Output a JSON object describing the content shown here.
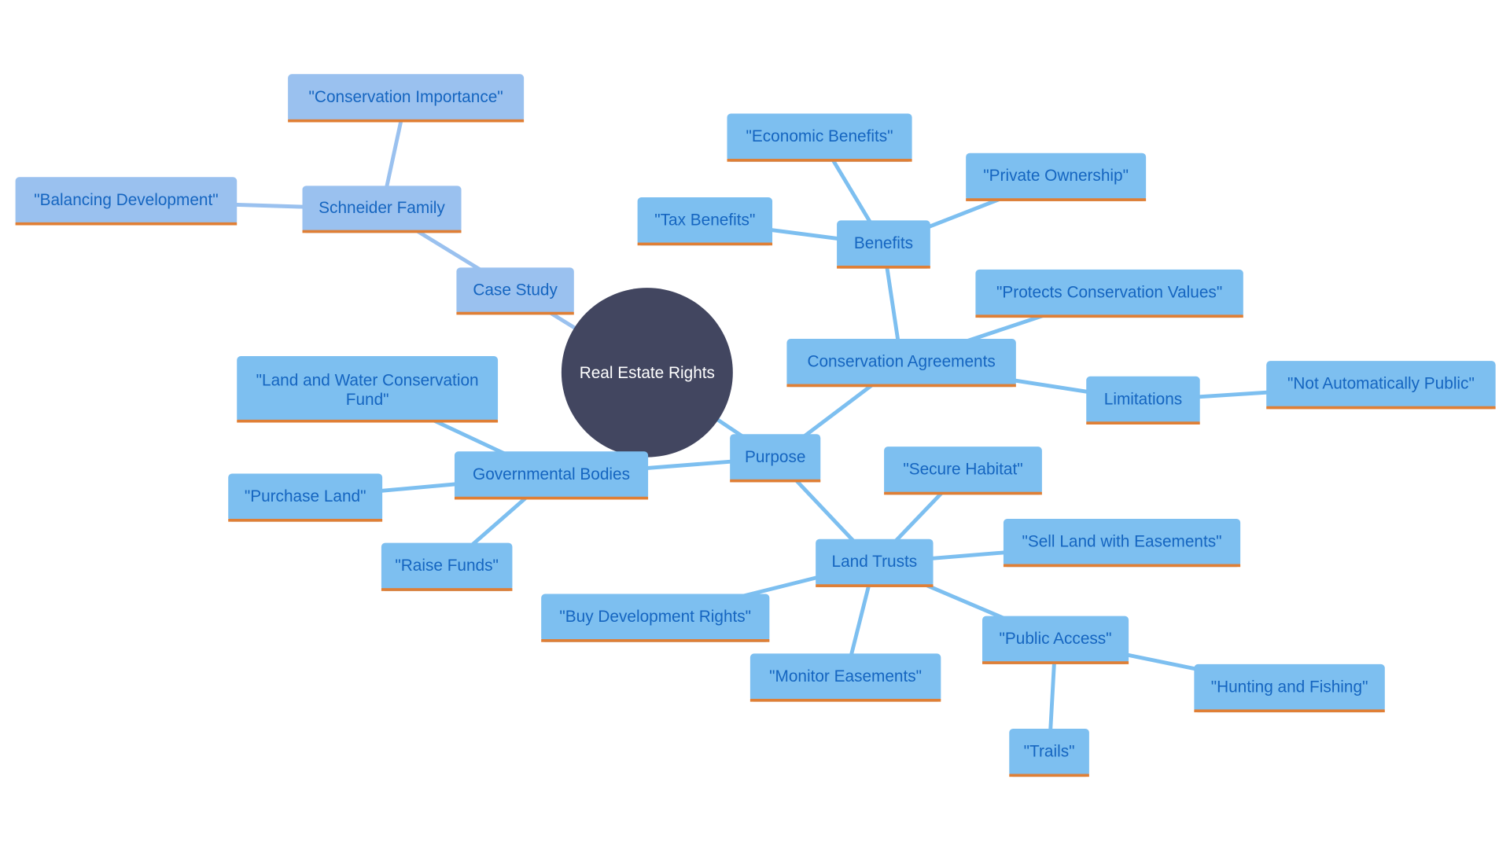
{
  "colors": {
    "background": "#ffffff",
    "root_fill": "#424660",
    "root_text": "#ffffff",
    "node_fill_primary": "#7dbff0",
    "node_fill_case": "#9ac1ef",
    "node_text": "#1565c0",
    "node_underline": "#e07f35",
    "edge_primary": "#7dbff0",
    "edge_case": "#9ac1ef"
  },
  "diagram": {
    "type": "mindmap",
    "root": {
      "id": "root",
      "label": "Real Estate Rights"
    },
    "nodes": [
      {
        "id": "case-study",
        "label": "Case Study",
        "parent": "root",
        "group": "case"
      },
      {
        "id": "schneider-family",
        "label": "Schneider Family",
        "parent": "case-study",
        "group": "case"
      },
      {
        "id": "conservation-importance",
        "label": "\"Conservation Importance\"",
        "parent": "schneider-family",
        "group": "case"
      },
      {
        "id": "balancing-development",
        "label": "\"Balancing Development\"",
        "parent": "schneider-family",
        "group": "case"
      },
      {
        "id": "purpose",
        "label": "Purpose",
        "parent": "root",
        "group": "primary"
      },
      {
        "id": "conservation-agreements",
        "label": "Conservation Agreements",
        "parent": "purpose",
        "group": "primary"
      },
      {
        "id": "benefits",
        "label": "Benefits",
        "parent": "conservation-agreements",
        "group": "primary"
      },
      {
        "id": "economic-benefits",
        "label": "\"Economic Benefits\"",
        "parent": "benefits",
        "group": "primary"
      },
      {
        "id": "private-ownership",
        "label": "\"Private Ownership\"",
        "parent": "benefits",
        "group": "primary"
      },
      {
        "id": "tax-benefits",
        "label": "\"Tax Benefits\"",
        "parent": "benefits",
        "group": "primary"
      },
      {
        "id": "protects-conservation-values",
        "label": "\"Protects Conservation Values\"",
        "parent": "conservation-agreements",
        "group": "primary"
      },
      {
        "id": "limitations",
        "label": "Limitations",
        "parent": "conservation-agreements",
        "group": "primary"
      },
      {
        "id": "not-automatically-public",
        "label": "\"Not Automatically Public\"",
        "parent": "limitations",
        "group": "primary"
      },
      {
        "id": "governmental-bodies",
        "label": "Governmental Bodies",
        "parent": "purpose",
        "group": "primary"
      },
      {
        "id": "lwcf",
        "label": "\"Land and Water Conservation Fund\"",
        "lines": [
          "\"Land and Water Conservation",
          "Fund\""
        ],
        "parent": "governmental-bodies",
        "group": "primary"
      },
      {
        "id": "purchase-land",
        "label": "\"Purchase Land\"",
        "parent": "governmental-bodies",
        "group": "primary"
      },
      {
        "id": "raise-funds",
        "label": "\"Raise Funds\"",
        "parent": "governmental-bodies",
        "group": "primary"
      },
      {
        "id": "land-trusts",
        "label": "Land Trusts",
        "parent": "purpose",
        "group": "primary"
      },
      {
        "id": "secure-habitat",
        "label": "\"Secure Habitat\"",
        "parent": "land-trusts",
        "group": "primary"
      },
      {
        "id": "sell-land-with-easements",
        "label": "\"Sell Land with Easements\"",
        "parent": "land-trusts",
        "group": "primary"
      },
      {
        "id": "buy-development-rights",
        "label": "\"Buy Development Rights\"",
        "parent": "land-trusts",
        "group": "primary"
      },
      {
        "id": "monitor-easements",
        "label": "\"Monitor Easements\"",
        "parent": "land-trusts",
        "group": "primary"
      },
      {
        "id": "public-access",
        "label": "\"Public Access\"",
        "parent": "land-trusts",
        "group": "primary"
      },
      {
        "id": "hunting-and-fishing",
        "label": "\"Hunting and Fishing\"",
        "parent": "public-access",
        "group": "primary"
      },
      {
        "id": "trails",
        "label": "\"Trails\"",
        "parent": "public-access",
        "group": "primary"
      }
    ]
  }
}
